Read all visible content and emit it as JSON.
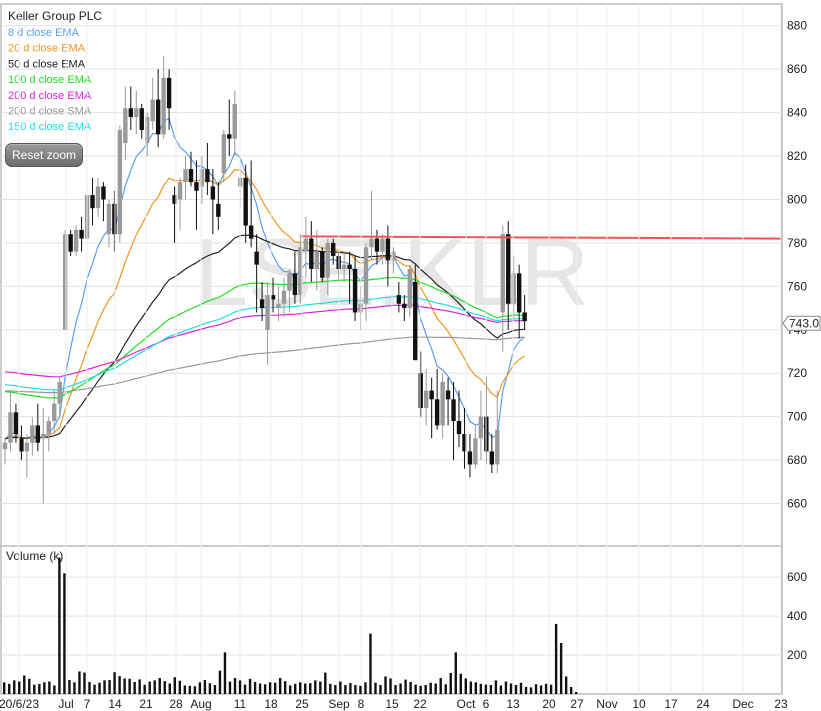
{
  "chart_data": [
    {
      "type": "candlestick",
      "title": "Keller Group PLC",
      "watermark": "LSE:KLR",
      "ylim": [
        640,
        890
      ],
      "yticks": [
        660,
        680,
        700,
        720,
        740,
        760,
        780,
        800,
        820,
        840,
        860,
        880
      ],
      "last_price_label": "743.0",
      "last_price": 743,
      "resistance_line": {
        "from": 783,
        "to": 782,
        "color": "#ee5555"
      },
      "legend": [
        {
          "label": "8 d close EMA",
          "color": "#5a9ff0"
        },
        {
          "label": "20 d close EMA",
          "color": "#f0961e"
        },
        {
          "label": "50 d close EMA",
          "color": "#222222"
        },
        {
          "label": "100 d close EMA",
          "color": "#22dd22"
        },
        {
          "label": "200 d close EMA",
          "color": "#dd22dd"
        },
        {
          "label": "200 d close SMA",
          "color": "#999999"
        },
        {
          "label": "150 d close EMA",
          "color": "#22dddd"
        }
      ],
      "candles": [
        [
          685,
          690,
          678,
          688
        ],
        [
          688,
          712,
          684,
          702
        ],
        [
          702,
          706,
          688,
          692
        ],
        [
          690,
          696,
          680,
          684
        ],
        [
          684,
          692,
          672,
          688
        ],
        [
          688,
          700,
          682,
          696
        ],
        [
          696,
          706,
          684,
          688
        ],
        [
          690,
          704,
          660,
          692
        ],
        [
          692,
          700,
          684,
          698
        ],
        [
          698,
          712,
          692,
          706
        ],
        [
          706,
          718,
          700,
          716
        ],
        [
          740,
          786,
          740,
          784
        ],
        [
          784,
          786,
          774,
          776
        ],
        [
          776,
          788,
          774,
          786
        ],
        [
          786,
          792,
          776,
          782
        ],
        [
          782,
          806,
          780,
          802
        ],
        [
          802,
          810,
          788,
          796
        ],
        [
          796,
          810,
          792,
          806
        ],
        [
          806,
          808,
          790,
          800
        ],
        [
          784,
          800,
          778,
          798
        ],
        [
          798,
          804,
          776,
          784
        ],
        [
          784,
          834,
          780,
          832
        ],
        [
          826,
          852,
          818,
          842
        ],
        [
          842,
          852,
          832,
          838
        ],
        [
          838,
          850,
          830,
          842
        ],
        [
          842,
          844,
          828,
          832
        ],
        [
          826,
          840,
          820,
          838
        ],
        [
          836,
          856,
          832,
          846
        ],
        [
          846,
          860,
          824,
          830
        ],
        [
          830,
          866,
          828,
          856
        ],
        [
          856,
          860,
          832,
          842
        ],
        [
          802,
          806,
          780,
          798
        ],
        [
          800,
          810,
          786,
          808
        ],
        [
          808,
          820,
          800,
          814
        ],
        [
          814,
          822,
          806,
          808
        ],
        [
          808,
          818,
          786,
          804
        ],
        [
          806,
          820,
          798,
          814
        ],
        [
          814,
          826,
          802,
          808
        ],
        [
          806,
          814,
          784,
          800
        ],
        [
          798,
          808,
          786,
          792
        ],
        [
          812,
          832,
          808,
          830
        ],
        [
          830,
          846,
          820,
          828
        ],
        [
          828,
          850,
          820,
          844
        ],
        [
          806,
          818,
          796,
          810
        ],
        [
          810,
          816,
          780,
          788
        ],
        [
          788,
          818,
          778,
          782
        ],
        [
          776,
          784,
          748,
          770
        ],
        [
          754,
          762,
          744,
          750
        ],
        [
          740,
          762,
          724,
          756
        ],
        [
          756,
          764,
          748,
          754
        ],
        [
          750,
          760,
          744,
          752
        ],
        [
          752,
          764,
          746,
          758
        ],
        [
          758,
          768,
          748,
          766
        ],
        [
          766,
          776,
          752,
          756
        ],
        [
          756,
          784,
          752,
          778
        ],
        [
          776,
          792,
          764,
          782
        ],
        [
          782,
          790,
          762,
          768
        ],
        [
          768,
          786,
          758,
          776
        ],
        [
          776,
          778,
          762,
          764
        ],
        [
          764,
          782,
          756,
          780
        ],
        [
          780,
          782,
          770,
          774
        ],
        [
          774,
          776,
          762,
          768
        ],
        [
          768,
          776,
          762,
          770
        ],
        [
          770,
          776,
          752,
          768
        ],
        [
          768,
          774,
          744,
          748
        ],
        [
          748,
          760,
          740,
          752
        ],
        [
          752,
          780,
          744,
          778
        ],
        [
          778,
          804,
          772,
          782
        ],
        [
          782,
          786,
          770,
          776
        ],
        [
          776,
          784,
          770,
          782
        ],
        [
          782,
          788,
          760,
          772
        ],
        [
          772,
          778,
          766,
          776
        ],
        [
          756,
          762,
          748,
          752
        ],
        [
          752,
          756,
          744,
          750
        ],
        [
          750,
          770,
          746,
          768
        ],
        [
          762,
          770,
          730,
          726
        ],
        [
          720,
          730,
          700,
          704
        ],
        [
          704,
          722,
          696,
          712
        ],
        [
          712,
          718,
          690,
          708
        ],
        [
          708,
          722,
          694,
          696
        ],
        [
          696,
          720,
          690,
          716
        ],
        [
          712,
          718,
          696,
          708
        ],
        [
          708,
          716,
          680,
          698
        ],
        [
          698,
          712,
          686,
          692
        ],
        [
          692,
          704,
          676,
          684
        ],
        [
          684,
          692,
          672,
          678
        ],
        [
          678,
          696,
          676,
          690
        ],
        [
          690,
          712,
          680,
          700
        ],
        [
          700,
          718,
          678,
          684
        ],
        [
          684,
          692,
          674,
          678
        ],
        [
          678,
          712,
          674,
          694
        ],
        [
          748,
          788,
          730,
          784
        ],
        [
          784,
          790,
          740,
          752
        ],
        [
          752,
          774,
          744,
          766
        ],
        [
          766,
          770,
          736,
          748
        ],
        [
          748,
          756,
          740,
          744
        ]
      ]
    },
    {
      "type": "bar",
      "title": "Volume (k)",
      "ylim": [
        0,
        760
      ],
      "yticks": [
        200,
        400,
        600
      ],
      "xtick_labels": [
        "20/6/23",
        "Jul",
        "7",
        "14",
        "21",
        "28",
        "Aug",
        "11",
        "18",
        "25",
        "Sep",
        "8",
        "15",
        "22",
        "Oct",
        "6",
        "13",
        "20",
        "27",
        "Nov",
        "10",
        "17",
        "24",
        "Dec",
        "23"
      ],
      "values": [
        60,
        52,
        70,
        64,
        95,
        78,
        48,
        52,
        60,
        64,
        44,
        700,
        620,
        72,
        60,
        116,
        110,
        62,
        48,
        58,
        70,
        72,
        112,
        92,
        80,
        78,
        62,
        75,
        48,
        64,
        70,
        82,
        66,
        54,
        86,
        68,
        44,
        42,
        40,
        60,
        72,
        55,
        46,
        120,
        214,
        64,
        82,
        70,
        48,
        78,
        62,
        54,
        50,
        60,
        58,
        82,
        66,
        44,
        52,
        60,
        54,
        56,
        70,
        64,
        110,
        52,
        46,
        64,
        46,
        56,
        46,
        42,
        60,
        310,
        58,
        46,
        90,
        80,
        46,
        54,
        74,
        62,
        48,
        42,
        46,
        58,
        54,
        82,
        50,
        108,
        214,
        104,
        80,
        64,
        60,
        52,
        48,
        46,
        70,
        44,
        64,
        54,
        46,
        58,
        36,
        34,
        50,
        44,
        52,
        48,
        360,
        262,
        90,
        36,
        10
      ]
    }
  ]
}
